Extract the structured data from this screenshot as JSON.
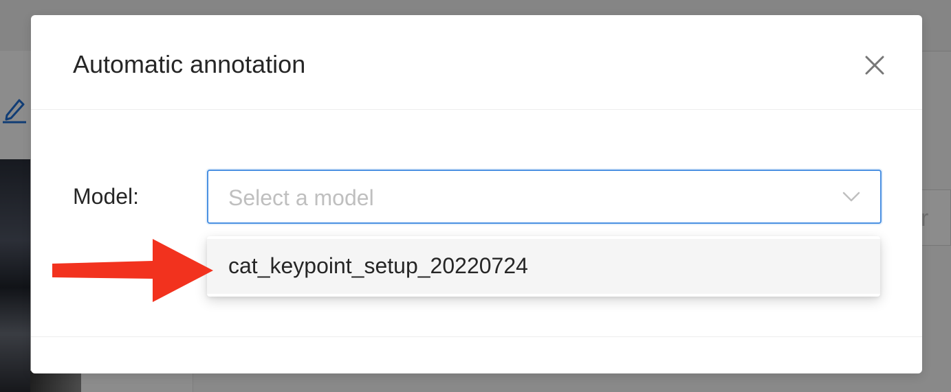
{
  "modal": {
    "title": "Automatic annotation",
    "close_icon": "close-icon"
  },
  "form": {
    "model_label": "Model:",
    "model_select": {
      "placeholder": "Select a model",
      "icon": "chevron-down-icon"
    },
    "dropdown_options": [
      {
        "label": "cat_keypoint_setup_20220724"
      }
    ]
  },
  "background": {
    "partial_text": "r",
    "edit_icon": "pencil-icon"
  },
  "annotation": {
    "arrow_icon": "red-arrow",
    "arrow_color": "#f2321e"
  },
  "colors": {
    "accent": "#4a90e2",
    "text": "#262626",
    "placeholder": "#bfbfbf",
    "option_hover": "#f5f5f5"
  }
}
